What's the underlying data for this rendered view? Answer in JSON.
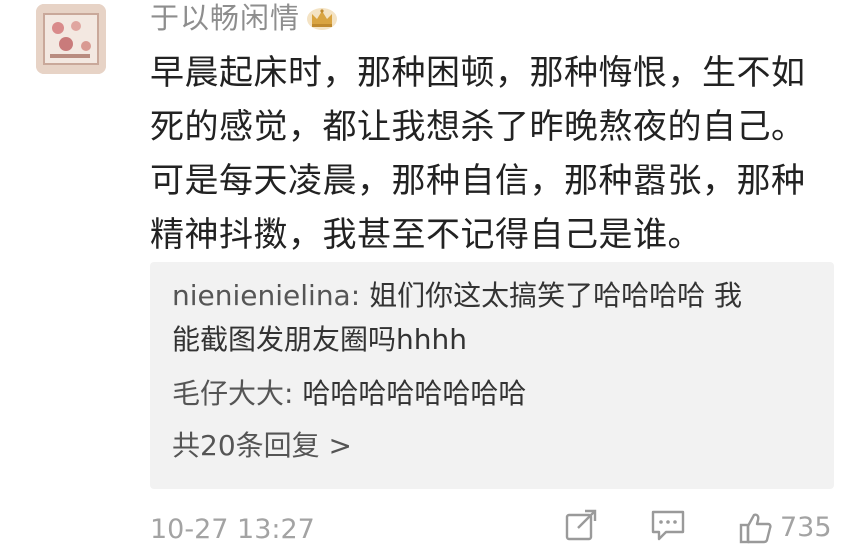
{
  "post": {
    "username": "于以畅闲情",
    "badge_icon": "crown-icon",
    "content_lines": [
      "早晨起床时，那种困顿，那种悔恨，生不如",
      "死的感觉，都让我想杀了昨晚熬夜的自己。",
      "可是每天凌晨，那种自信，那种嚣张，那种",
      "精神抖擞，我甚至不记得自己是谁。"
    ]
  },
  "replies": [
    {
      "user": "nienienielina:",
      "text_lines": [
        "姐们你这太搞笑了哈哈哈哈 我",
        "能截图发朋友圈吗hhhh"
      ]
    },
    {
      "user": "毛仔大大:",
      "text_lines": [
        "哈哈哈哈哈哈哈哈"
      ]
    }
  ],
  "more_replies_label": "共20条回复 >",
  "footer": {
    "timestamp": "10-27 13:27",
    "like_count": "735"
  },
  "colors": {
    "secondary_text": "#8e8e8e",
    "body_text": "#222222",
    "reply_bg": "#f2f2f2",
    "crown_gold": "#d9a441"
  }
}
